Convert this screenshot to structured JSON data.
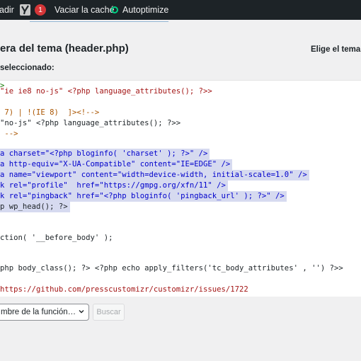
{
  "admin_bar": {
    "add_new": "adir",
    "notifications_count": "1",
    "clear_cache": "Vaciar la caché",
    "autoptimize": "Autoptimize"
  },
  "header": {
    "title": "era del tema (header.php)",
    "choose_theme": "Elige el tema a",
    "selected_label": "seleccionado:"
  },
  "code_lines": [
    {
      "text": ">"
    },
    {
      "text": "\"ie ie8 no-js\" <?php language_attributes(); ?>>"
    },
    {
      "text": ""
    },
    {
      "text": " 7) | !(IE 8)  ]><!-->"
    },
    {
      "text": "\"no-js\" <?php language_attributes(); ?>>"
    },
    {
      "text": " -->"
    },
    {
      "text": ""
    },
    {
      "text": "a charset=\"<?php bloginfo( 'charset' ); ?>\" />"
    },
    {
      "text": "a http-equiv=\"X-UA-Compatible\" content=\"IE=EDGE\" />"
    },
    {
      "text": "a name=\"viewport\" content=\"width=device-width, initial-scale=1.0\" />"
    },
    {
      "text": "k rel=\"profile\"  href=\"https://gmpg.org/xfn/11\" />"
    },
    {
      "text": "k rel=\"pingback\" href=\"<?php bloginfo( 'pingback_url' ); ?>\" />"
    },
    {
      "text": "p wp_head(); ?>"
    },
    {
      "text": ""
    },
    {
      "text": ""
    },
    {
      "text": "ction( '__before_body' );"
    },
    {
      "text": ""
    },
    {
      "text": ""
    },
    {
      "text": "php body_class(); ?> <?php echo apply_filters('tc_body_attributes' , '') ?>>"
    },
    {
      "text": ""
    },
    {
      "text": "https://github.com/presscustomizr/customizr/issues/1722"
    }
  ],
  "bottom": {
    "function_select_value": "mbre de la función…",
    "search_button": "Buscar"
  }
}
